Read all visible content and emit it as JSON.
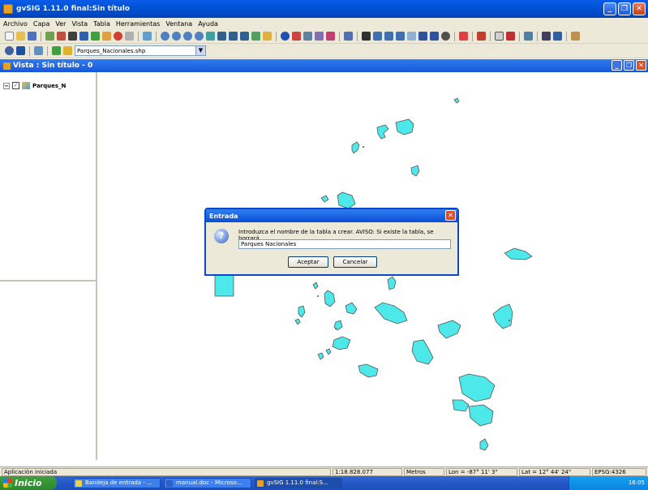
{
  "window": {
    "title": "gvSIG 1.11.0 final:Sin título"
  },
  "menu": [
    "Archivo",
    "Capa",
    "Ver",
    "Vista",
    "Tabla",
    "Herramientas",
    "Ventana",
    "Ayuda"
  ],
  "toolbar": {
    "layer_select_value": "Parques_Nacionales.shp"
  },
  "view": {
    "title": "Vista : Sin título - 0"
  },
  "toc": {
    "layers": [
      {
        "name": "Parques_N",
        "checked": true
      }
    ]
  },
  "dialog": {
    "title": "Entrada",
    "message": "Introduzca el nombre de la tabla a crear. AVISO: Si existe la tabla, se borrará.",
    "input_value": "Parques Nacionales",
    "ok_label": "Aceptar",
    "cancel_label": "Cancelar"
  },
  "statusbar": {
    "message": "Aplicación iniciada",
    "scale": "1:18.828.077",
    "units": "Metros",
    "lon": "Lon = -87° 11' 3\"",
    "lat": "Lat = 12° 44' 24\"",
    "crs": "EPSG:4326"
  },
  "taskbar": {
    "start_label": "Inicio",
    "tasks": [
      "Bandeja de entrada - ...",
      "manual.doc - Microso...",
      "gvSIG 1.11.0 final:S..."
    ],
    "clock": "16:05"
  },
  "colors": {
    "polygon_fill": "#4de8ea",
    "polygon_stroke": "#555555",
    "titlebar": "#0054e3"
  }
}
